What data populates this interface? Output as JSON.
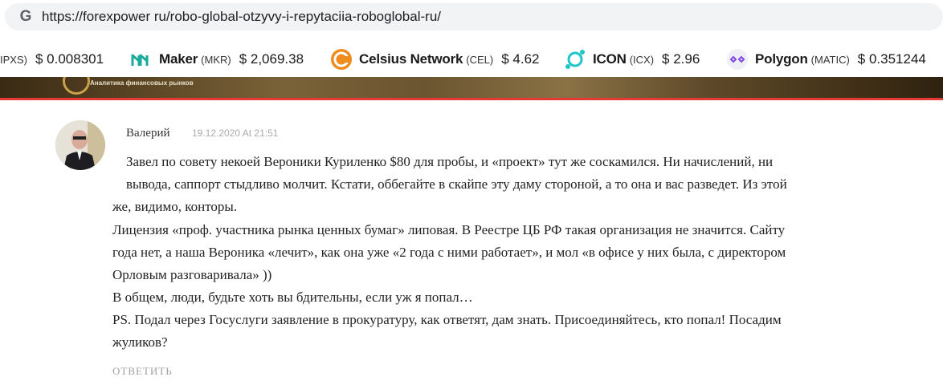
{
  "browser": {
    "url": "https://forexpower ru/robo-global-otzyvy-i-repytaciia-roboglobal-ru/"
  },
  "ticker": [
    {
      "symbol": "IPXS)",
      "price": "$ 0.008301",
      "icon": "truncated"
    },
    {
      "name": "Maker",
      "symbol": "(MKR)",
      "price": "$ 2,069.38",
      "icon": "maker-icon",
      "color": "#1aab9b"
    },
    {
      "name": "Celsius Network",
      "symbol": "(CEL)",
      "price": "$ 4.62",
      "icon": "celsius-icon",
      "color": "#f08c1f"
    },
    {
      "name": "ICON",
      "symbol": "(ICX)",
      "price": "$ 2.96",
      "icon": "icon-icx-icon",
      "color": "#1fc5c9"
    },
    {
      "name": "Polygon",
      "symbol": "(MATIC)",
      "price": "$ 0.351244",
      "icon": "polygon-icon",
      "color": "#8247e5"
    }
  ],
  "banner": {
    "text": "Аналитика финансовых рынков",
    "accent": "#e53935"
  },
  "comment": {
    "author": "Валерий",
    "date": "19.12.2020 At 21:51",
    "lines": [
      "Завел по совету некоей Вероники Куриленко $80 для пробы, и «проект» тут же соскамился. Ни начислений, ни",
      "вывода, саппорт стыдливо молчит. Кстати, оббегайте в скайпе эту даму стороной, а то она и вас разведет. Из этой",
      "же, видимо, конторы.",
      "Лицензия «проф. участника рынка ценных бумаг» липовая. В Реестре ЦБ РФ такая организация не значится. Сайту",
      "года нет, а наша Вероника «лечит», как она уже «2 года с ними работает», и мол «в офисе у них была, с директором",
      "Орловым разговаривала» ))",
      "В общем, люди, будьте хоть вы бдительны, если уж я попал…",
      "PS. Подал через Госуслуги заявление в прокуратуру, как ответят, дам знать. Присоединяйтесь, кто попал! Посадим",
      "жуликов?"
    ],
    "reply_label": "ОТВЕТИТЬ"
  }
}
